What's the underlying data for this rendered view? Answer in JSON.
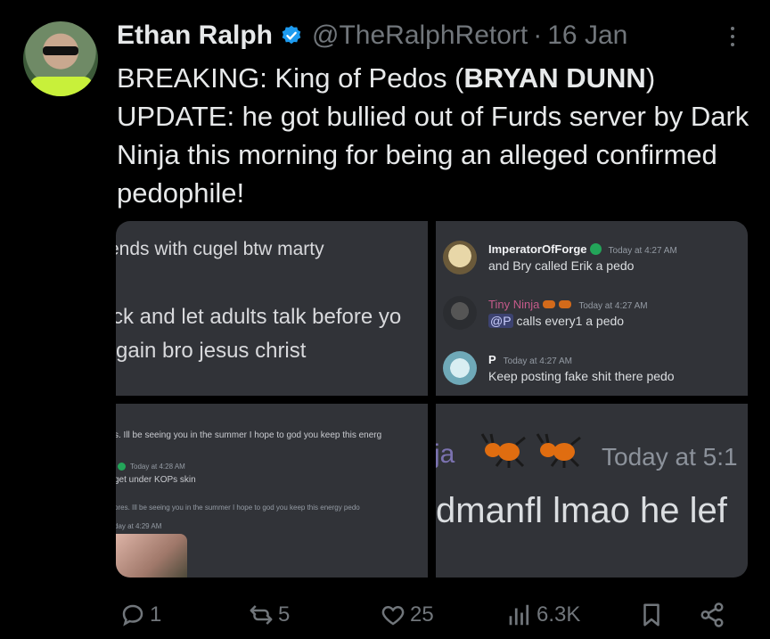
{
  "tweet": {
    "author_name": "Ethan Ralph",
    "handle": "@TheRalphRetort",
    "separator": "·",
    "date": "16 Jan",
    "text_prefix": "BREAKING: King of Pedos (",
    "text_bold": "BRYAN DUNN",
    "text_suffix": ") UPDATE: he got bullied out of Furds server by Dark Ninja this morning for being an alleged confirmed pedophile!"
  },
  "media": {
    "cell1": {
      "line1": "ends with cugel btw marty",
      "line2": "ck and let adults talk before yo",
      "line3": "gain bro jesus christ"
    },
    "cell2": {
      "messages": [
        {
          "author": "ImperatorOfForge",
          "timestamp": "Today at 4:27 AM",
          "body": "and Bry called Erik a pedo"
        },
        {
          "author": "Tiny Ninja",
          "timestamp": "Today at 4:27 AM",
          "mention": "@P",
          "body": "calls every1 a pedo"
        },
        {
          "author": "P",
          "timestamp": "Today at 4:27 AM",
          "body": "Keep posting fake shit there pedo"
        }
      ]
    },
    "cell3": {
      "line1": "s. Ill be seeing you in the summer I hope to god you keep this energ",
      "ts1": "Today at 4:28 AM",
      "line2": "get under KOPs skin",
      "line3": "ores. Ill be seeing you in the summer I hope to god you keep this energy pedo",
      "ts2": "day at 4:29 AM"
    },
    "cell4": {
      "name_fragment": "ja",
      "timestamp": "Today at 5:1",
      "body": "dmanfl lmao he lef"
    }
  },
  "actions": {
    "replies": "1",
    "reposts": "5",
    "likes": "25",
    "views": "6.3K"
  },
  "icons": {
    "verified": "verified-badge-icon",
    "more": "more-vertical-icon",
    "reply": "reply-icon",
    "repost": "repost-icon",
    "like": "heart-icon",
    "views": "views-icon",
    "bookmark": "bookmark-icon",
    "share": "share-icon"
  },
  "colors": {
    "background": "#000000",
    "verified": "#1d9bf0",
    "muted": "#71767b",
    "discord_bg": "#313338"
  }
}
